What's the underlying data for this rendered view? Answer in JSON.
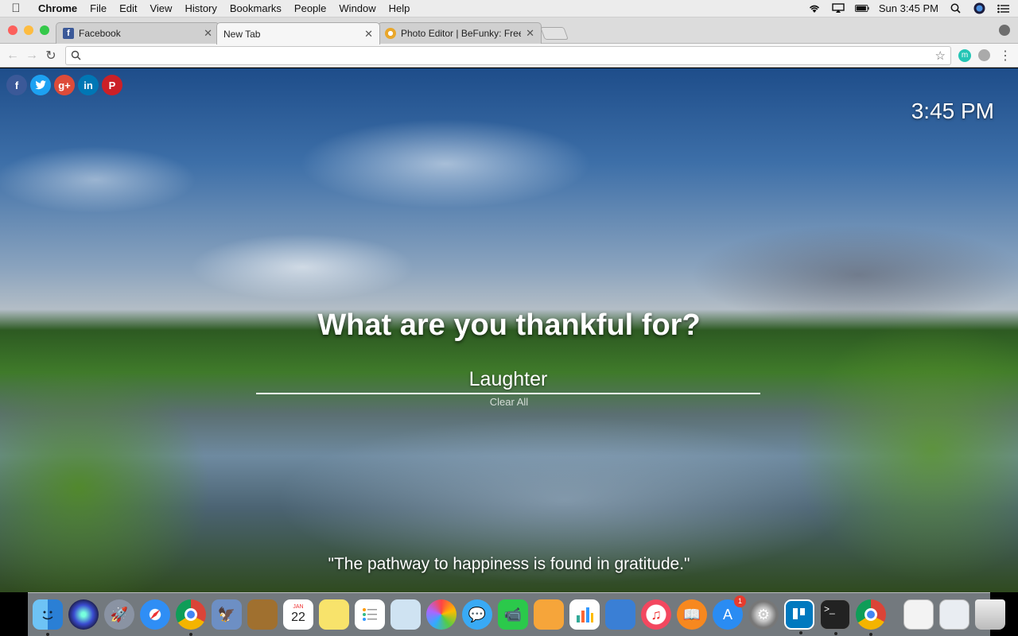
{
  "menubar": {
    "app_name": "Chrome",
    "items": [
      "File",
      "Edit",
      "View",
      "History",
      "Bookmarks",
      "People",
      "Window",
      "Help"
    ],
    "clock": "Sun 3:45 PM"
  },
  "tabs": [
    {
      "title": "Facebook",
      "favicon_color": "#3b5998"
    },
    {
      "title": "New Tab",
      "favicon_color": ""
    },
    {
      "title": "Photo Editor | BeFunky: Free O",
      "favicon_color": "#e9a72b"
    }
  ],
  "omnibox": {
    "value": "",
    "placeholder": ""
  },
  "social_links": [
    {
      "name": "facebook",
      "glyph": "f",
      "color": "#3b5998"
    },
    {
      "name": "twitter",
      "glyph": "t",
      "color": "#1da1f2"
    },
    {
      "name": "google-plus",
      "glyph": "g+",
      "color": "#dd4b39"
    },
    {
      "name": "linkedin",
      "glyph": "in",
      "color": "#0077b5"
    },
    {
      "name": "pinterest",
      "glyph": "P",
      "color": "#cb2027"
    }
  ],
  "page": {
    "time": "3:45 PM",
    "question": "What are you thankful for?",
    "answer_value": "Laughter",
    "clear_label": "Clear All",
    "quote": "\"The pathway to happiness is found in gratitude.\""
  },
  "dock": {
    "calendar_month": "JAN",
    "calendar_day": "22",
    "app_store_badge": "1",
    "apps": [
      "finder",
      "siri",
      "launchpad",
      "safari",
      "chrome",
      "preview",
      "notes-book",
      "calendar",
      "stickies",
      "reminders",
      "photo-booth",
      "photos",
      "messages",
      "facetime",
      "pages",
      "numbers",
      "keynote",
      "itunes",
      "ibooks",
      "app-store",
      "system-preferences",
      "trello",
      "terminal",
      "chrome-2"
    ]
  }
}
